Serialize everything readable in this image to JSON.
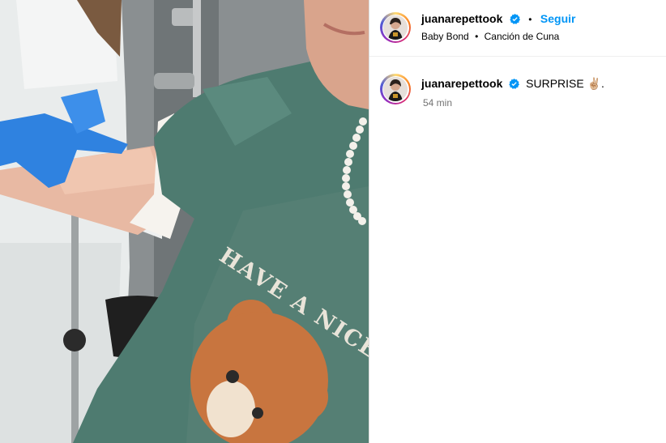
{
  "post": {
    "username": "juanarepettook",
    "follow_label": "Seguir",
    "audio": {
      "artist": "Baby Bond",
      "song": "Canción de Cuna"
    }
  },
  "caption": {
    "username": "juanarepettook",
    "text": "SURPRISE",
    "emoji": "✌🏼",
    "trailing": ".",
    "time": "54 min"
  },
  "media": {
    "sweatshirt_text": "HAVE A NICE DAY"
  },
  "colors": {
    "verified_blue": "#0095f6",
    "secondary_text": "#737373",
    "sweatshirt_green": "#4e7b70"
  }
}
